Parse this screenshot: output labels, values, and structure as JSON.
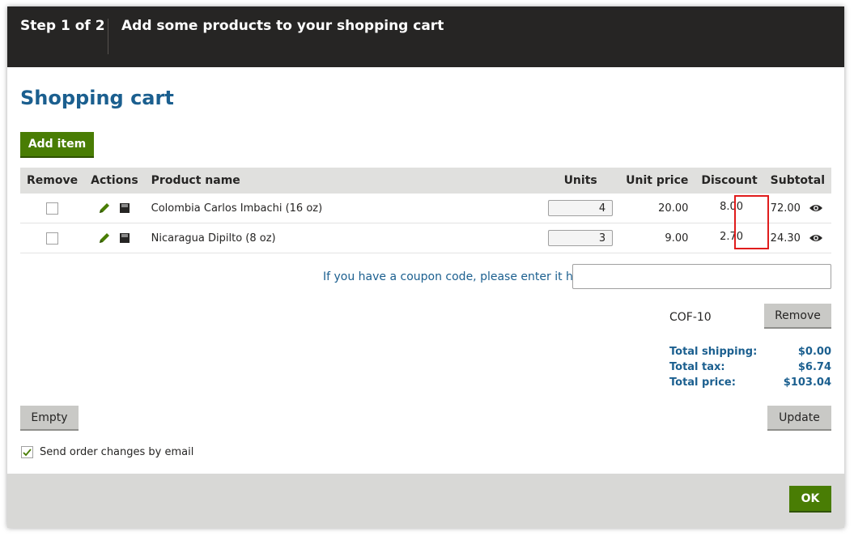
{
  "header": {
    "step": "Step 1 of 2",
    "title": "Add some products to your shopping cart"
  },
  "page_title": "Shopping cart",
  "add_item_label": "Add item",
  "table": {
    "columns": {
      "remove": "Remove",
      "actions": "Actions",
      "product": "Product name",
      "units": "Units",
      "unit_price": "Unit price",
      "discount": "Discount",
      "subtotal": "Subtotal"
    },
    "rows": [
      {
        "product": "Colombia Carlos Imbachi (16 oz)",
        "units": "4",
        "unit_price": "20.00",
        "discount": "8.00",
        "subtotal": "72.00"
      },
      {
        "product": "Nicaragua Dipilto (8 oz)",
        "units": "3",
        "unit_price": "9.00",
        "discount": "2.70",
        "subtotal": "24.30"
      }
    ]
  },
  "coupon": {
    "label": "If you have a coupon code, please enter it here:",
    "input_value": "",
    "applied_code": "COF-10",
    "remove_label": "Remove"
  },
  "totals": {
    "shipping_label": "Total shipping:",
    "shipping_value": "$0.00",
    "tax_label": "Total tax:",
    "tax_value": "$6.74",
    "price_label": "Total price:",
    "price_value": "$103.04"
  },
  "buttons": {
    "empty": "Empty",
    "update": "Update",
    "ok": "OK"
  },
  "email_option": {
    "label": "Send order changes by email",
    "checked": true
  },
  "colors": {
    "header_bg": "#262524",
    "accent_blue": "#1b5f8f",
    "button_green": "#497d04",
    "highlight_red": "#e01c1c"
  },
  "icons": [
    "pencil-icon",
    "save-icon",
    "eye-icon",
    "checkmark-icon"
  ]
}
